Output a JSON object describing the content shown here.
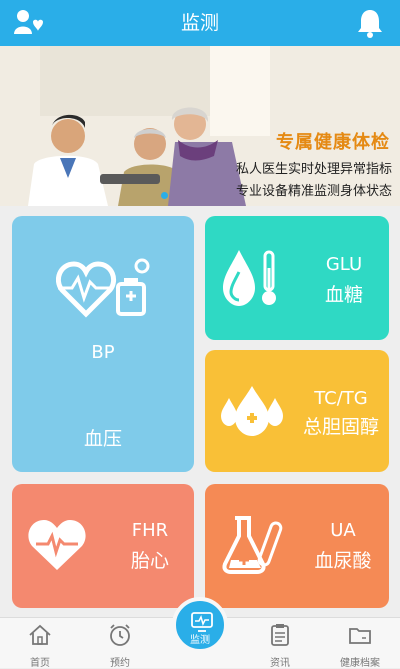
{
  "header": {
    "title": "监测",
    "left_icon": "family-users-icon",
    "right_icon": "bell-icon"
  },
  "banner": {
    "headline": "专属健康体检",
    "line1": "私人医生实时处理异常指标",
    "line2": "专业设备精准监测身体状态",
    "slide_indicator": "1"
  },
  "cards": {
    "bp": {
      "code": "BP",
      "name": "血压",
      "icon": "heart-pulse-bp-monitor-icon",
      "color": "#7fcbea"
    },
    "glu": {
      "code": "GLU",
      "name": "血糖",
      "icon": "blood-drop-thermometer-icon",
      "color": "#2fd9c4"
    },
    "tc": {
      "code": "TC/TG",
      "name": "总胆固醇",
      "icon": "drops-plus-icon",
      "color": "#f9c037"
    },
    "fhr": {
      "code": "FHR",
      "name": "胎心",
      "icon": "heart-ecg-icon",
      "color": "#f4896f"
    },
    "ua": {
      "code": "UA",
      "name": "血尿酸",
      "icon": "flask-test-tube-icon",
      "color": "#f58a55"
    }
  },
  "tabbar": {
    "tabs": [
      {
        "label": "首页",
        "icon": "home-icon"
      },
      {
        "label": "预约",
        "icon": "alarm-clock-icon"
      },
      {
        "label": "监测",
        "icon": "monitor-icon",
        "active": true
      },
      {
        "label": "资讯",
        "icon": "clipboard-icon"
      },
      {
        "label": "健康档案",
        "icon": "folder-icon"
      }
    ]
  },
  "colors": {
    "accent": "#2aaee8",
    "background": "#eeeeee",
    "banner_headline": "#e58a14"
  }
}
